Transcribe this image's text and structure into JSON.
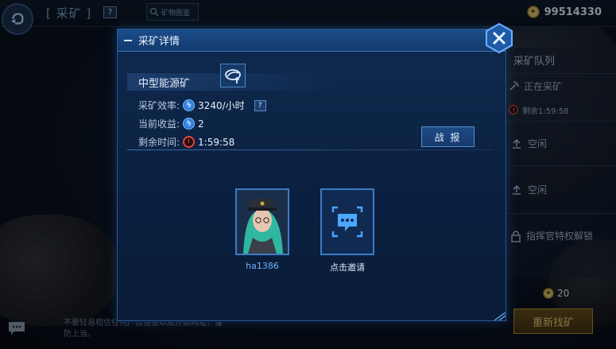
{
  "topbar": {
    "title": "[ 采矿 ]",
    "help": "?",
    "search_label": "矿物图鉴",
    "coins": "99514330",
    "coin_icon": "coin-icon"
  },
  "queue": {
    "title": "采矿队列",
    "rows": [
      {
        "label": "正在采矿",
        "sub": "剩余1:59:58"
      },
      {
        "label": "空闲"
      },
      {
        "label": "空闲"
      },
      {
        "label": "指挥官特权解锁"
      }
    ],
    "cost": "20",
    "find_button": "重新找矿"
  },
  "chat": {
    "note": "不要轻易相信任何广告信息以及开启网址，谨防上当。"
  },
  "dialog": {
    "title": "采矿详情",
    "mine_name": "中型能源矿",
    "rate_label": "采矿效率:",
    "rate_value": "3240/小时",
    "rate_help": "?",
    "income_label": "当前收益:",
    "income_value": "2",
    "time_label": "剩余时间:",
    "time_value": "1:59:58",
    "report_button": "战 报",
    "player_name": "ha1386",
    "invite_label": "点击邀请"
  },
  "colors": {
    "accent": "#3c7cc8",
    "header": "#1b4c8a",
    "timer": "#e0473e",
    "gold": "#d9b46a"
  }
}
